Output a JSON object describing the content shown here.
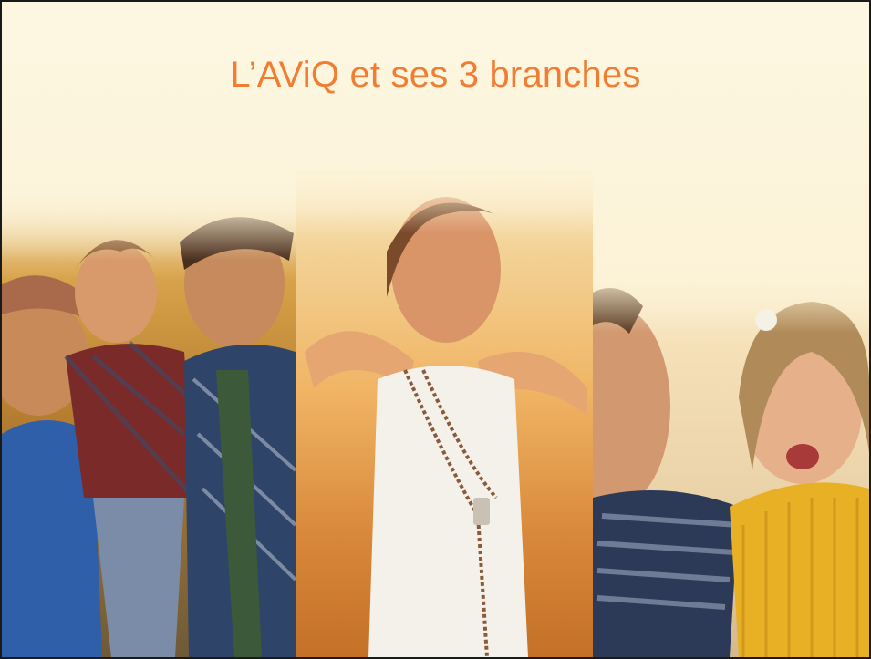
{
  "slide": {
    "title": "L’AViQ et ses 3 branches"
  },
  "colors": {
    "title": "#f07d32",
    "background": "#fcf2d6"
  },
  "photos": [
    {
      "name": "family-photo"
    },
    {
      "name": "woman-arms-open-photo"
    },
    {
      "name": "father-daughter-photo"
    }
  ]
}
